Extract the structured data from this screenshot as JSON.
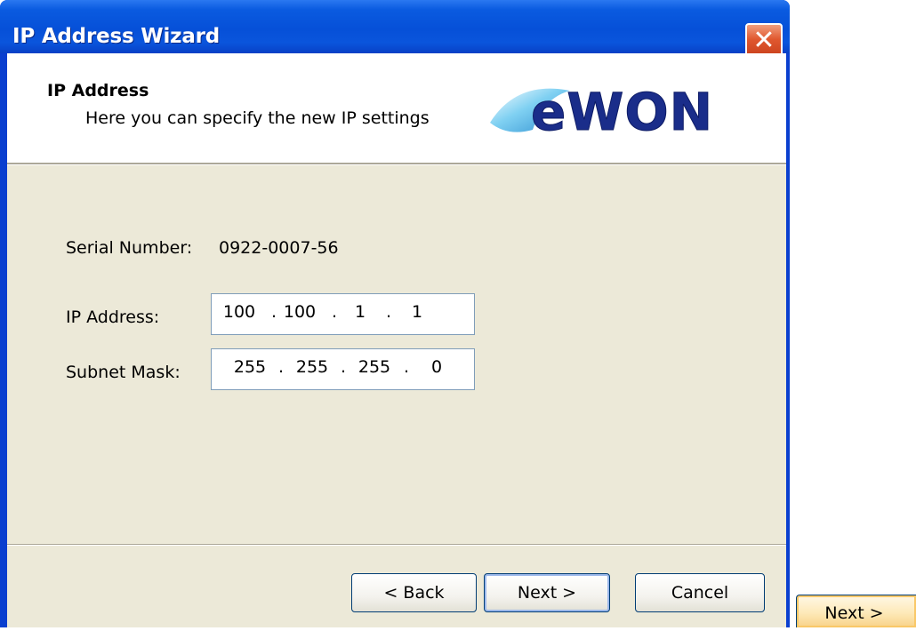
{
  "window": {
    "title": "IP Address Wizard",
    "close_glyph": "✕"
  },
  "header": {
    "title": "IP Address",
    "subtitle": "Here you can specify the new IP settings",
    "logo_text": "eWON"
  },
  "form": {
    "serial_label": "Serial Number:",
    "serial_value": "0922-0007-56",
    "ip_label": "IP Address:",
    "ip_octets": [
      "100",
      "100",
      "1",
      "1"
    ],
    "mask_label": "Subnet Mask:",
    "mask_octets": [
      "255",
      "255",
      "255",
      "0"
    ]
  },
  "buttons": {
    "back": "< Back",
    "next": "Next >",
    "cancel": "Cancel"
  },
  "floating": {
    "next": "Next >"
  },
  "colors": {
    "titlebar": "#0650d8",
    "dialog_bg": "#ece9d8",
    "logo_blue": "#1a2d8a",
    "logo_swoosh": "#58b8e6"
  },
  "icons": {
    "close": "close-icon",
    "logo": "ewon-logo"
  }
}
